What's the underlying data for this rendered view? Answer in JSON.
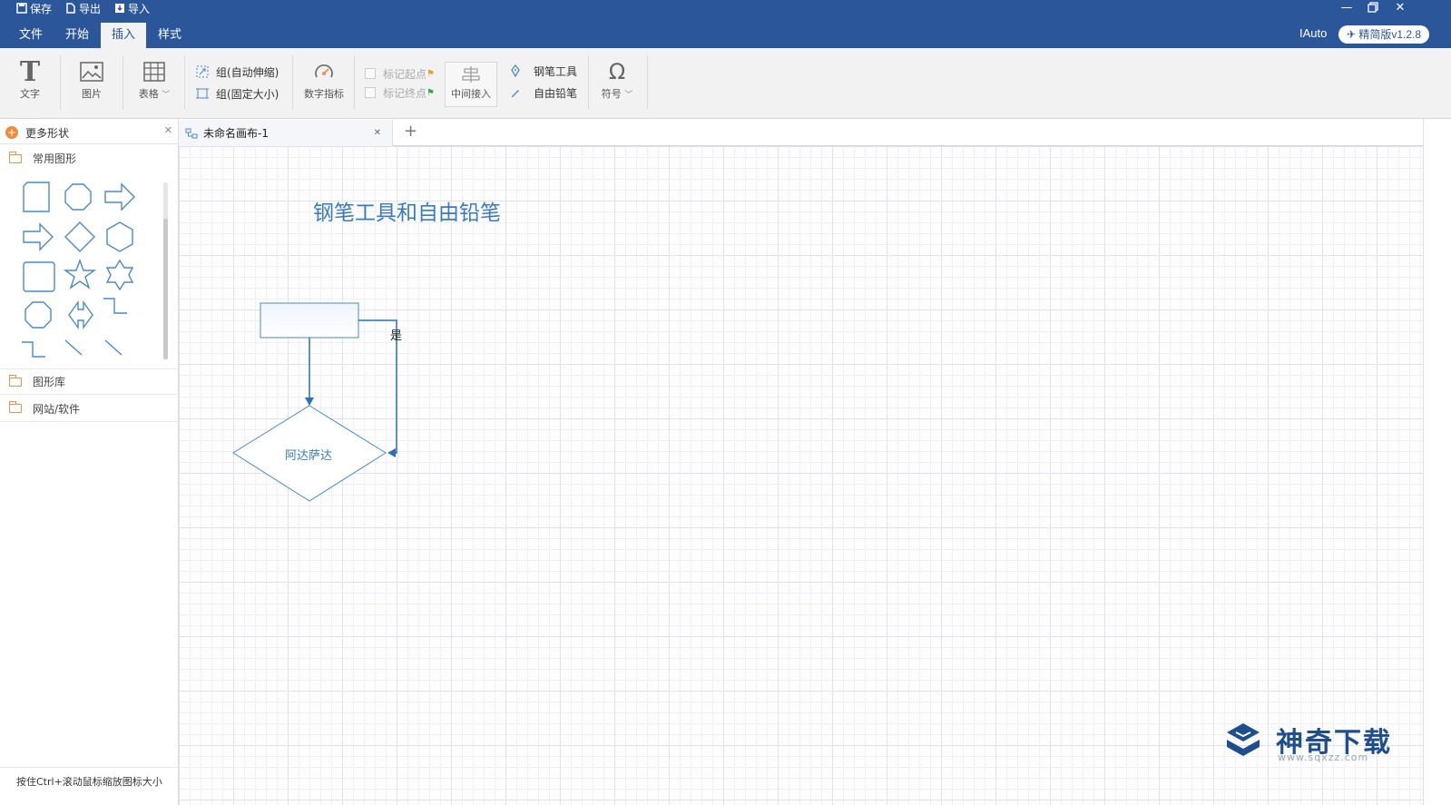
{
  "toolbar_quick": {
    "save": "保存",
    "export": "导出",
    "import": "导入"
  },
  "menu": {
    "tabs": [
      "文件",
      "开始",
      "插入",
      "样式"
    ],
    "active": "插入"
  },
  "header": {
    "user": "IAuto",
    "version": "精简版v1.2.8"
  },
  "ribbon": {
    "text_btn": "文字",
    "image_btn": "图片",
    "table_btn": "表格",
    "group_auto": "组(自动伸缩)",
    "group_fixed": "组(固定大小)",
    "digital_indicator": "数字指标",
    "mark_start": "标记起点",
    "mark_end": "标记终点",
    "middle_insert": "中间接入",
    "pen_tool": "钢笔工具",
    "free_pencil": "自由铅笔",
    "symbol": "符号"
  },
  "left_panel": {
    "title": "更多形状",
    "folders": {
      "common": "常用图形",
      "library": "图形库",
      "web": "网站/软件"
    },
    "tip": "按住Ctrl+滚动鼠标缩放图标大小"
  },
  "tab": {
    "name": "未命名画布-1"
  },
  "canvas": {
    "title": "钢笔工具和自由铅笔",
    "yes_label": "是",
    "diamond_label": "阿达萨达"
  },
  "watermark": {
    "name": "神奇下载",
    "url": "www.sqxzz.com"
  },
  "colors": {
    "titlebar": "#2b579a",
    "accent": "#3a7bbf",
    "shape_stroke": "#4a8ac9"
  }
}
